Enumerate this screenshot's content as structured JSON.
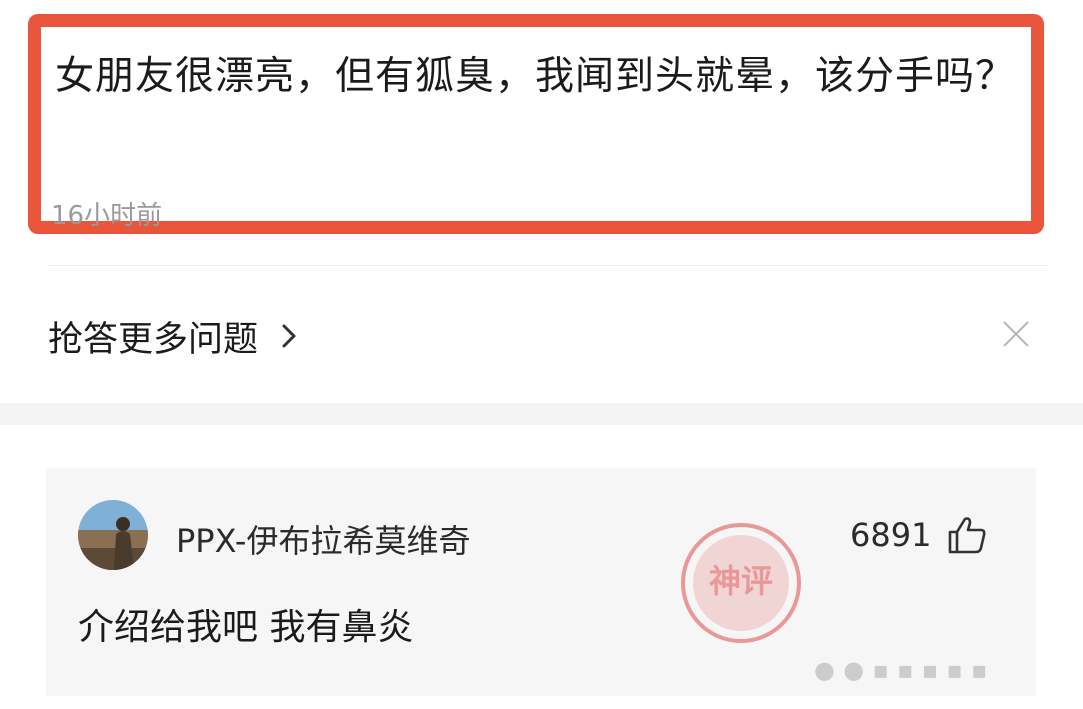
{
  "question": {
    "title": "女朋友很漂亮，但有狐臭，我闻到头就晕，该分手吗？",
    "time": "16小时前",
    "highlight_color": "#e8553a"
  },
  "more_questions": {
    "label": "抢答更多问题",
    "chevron_icon": "chevron-right-icon",
    "close_icon": "close-icon"
  },
  "answer": {
    "username": "PPX-伊布拉希莫维奇",
    "like_count": "6891",
    "like_icon": "thumbs-up-icon",
    "text": "介绍给我吧 我有鼻炎",
    "stamp_text": "神评",
    "stamp_color": "#e04a4a"
  }
}
